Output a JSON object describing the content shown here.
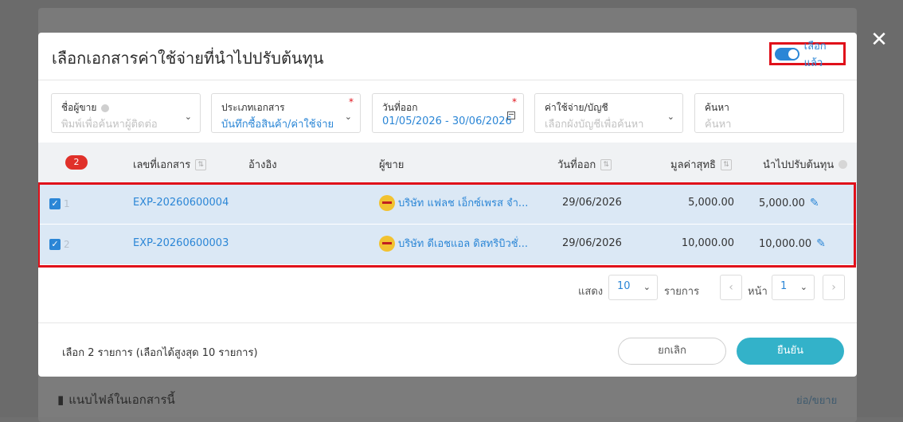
{
  "background": {
    "attach_label": "แนบไฟล์ในเอกสารนี้",
    "expand_link": "ย่อ/ขยาย"
  },
  "modal": {
    "title": "เลือกเอกสารค่าใช้จ่ายที่นำไปปรับต้นทุน",
    "toggle_label": "เลือกแล้ว",
    "toggle_on": true,
    "filters": {
      "vendor": {
        "label": "ชื่อผู้ขาย",
        "placeholder": "พิมพ์เพื่อค้นหาผู้ติดต่อ"
      },
      "doc_type": {
        "label": "ประเภทเอกสาร",
        "value": "บันทึกซื้อสินค้า/ค่าใช้จ่าย",
        "required_mark": "*"
      },
      "issue_date": {
        "label": "วันที่ออก",
        "value": "01/05/2026 - 30/06/2026",
        "required_mark": "*"
      },
      "expense_account": {
        "label": "ค่าใช้จ่าย/บัญชี",
        "placeholder": "เลือกผังบัญชีเพื่อค้นหา"
      },
      "search": {
        "label": "ค้นหา",
        "placeholder": "ค้นหา"
      }
    },
    "table": {
      "selected_count": "2",
      "headers": {
        "doc_no": "เลขที่เอกสาร",
        "reference": "อ้างอิง",
        "vendor": "ผู้ขาย",
        "issue_date": "วันที่ออก",
        "net_value": "มูลค่าสุทธิ",
        "cost_adjust": "นำไปปรับต้นทุน"
      },
      "rows": [
        {
          "num": "1",
          "doc_no": "EXP-20260600004",
          "reference": "",
          "vendor": "บริษัท แฟลช เอ็กซ์เพรส จำ...",
          "issue_date": "29/06/2026",
          "net_value": "5,000.00",
          "cost_adjust": "5,000.00",
          "checked": true
        },
        {
          "num": "2",
          "doc_no": "EXP-20260600003",
          "reference": "",
          "vendor": "บริษัท ดีเอชแอล ดิสทริบิวชั่...",
          "issue_date": "29/06/2026",
          "net_value": "10,000.00",
          "cost_adjust": "10,000.00",
          "checked": true
        }
      ]
    },
    "pagination": {
      "show_label": "แสดง",
      "page_size": "10",
      "items_label": "รายการ",
      "page_label": "หน้า",
      "page": "1"
    },
    "footer": {
      "selection_text": "เลือก 2 รายการ (เลือกได้สูงสุด 10 รายการ)",
      "cancel": "ยกเลิก",
      "confirm": "ยืนยัน"
    }
  },
  "colors": {
    "accent": "#2b86d6",
    "highlight_border": "#e0101a",
    "confirm_button": "#33b2c9",
    "selected_row": "#dbe8f5"
  }
}
